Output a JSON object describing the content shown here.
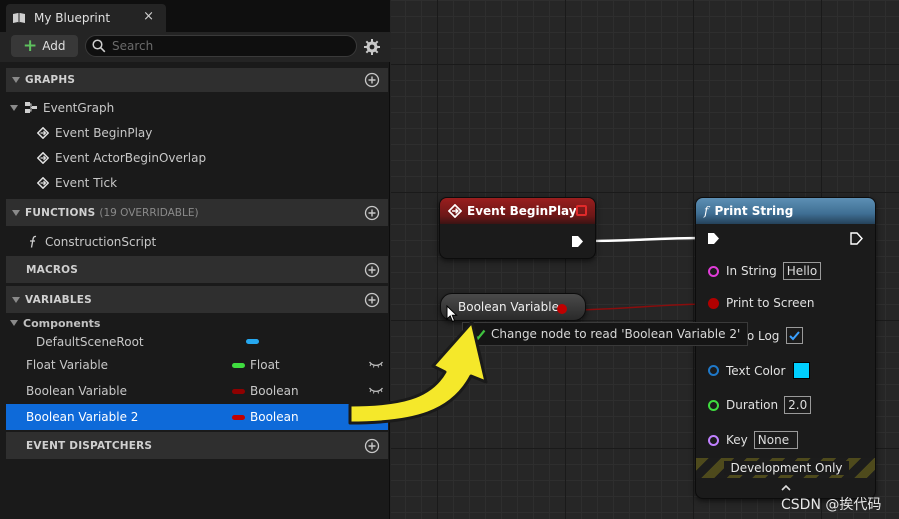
{
  "tab": {
    "title": "My Blueprint",
    "close": "×"
  },
  "toolbar": {
    "add_label": "Add",
    "search_placeholder": "Search"
  },
  "sections": {
    "graphs": "GRAPHS",
    "functions": "FUNCTIONS",
    "functions_note": "(19 OVERRIDABLE)",
    "macros": "MACROS",
    "variables": "VARIABLES",
    "event_dispatchers": "EVENT DISPATCHERS"
  },
  "graph_tree": {
    "event_graph": "EventGraph",
    "events": [
      "Event BeginPlay",
      "Event ActorBeginOverlap",
      "Event Tick"
    ]
  },
  "functions": [
    "ConstructionScript"
  ],
  "variables": {
    "components_label": "Components",
    "components": [
      {
        "name": "DefaultSceneRoot",
        "color": "#26a8f0"
      }
    ],
    "items": [
      {
        "name": "Float Variable",
        "type": "Float",
        "color": "#3fdc3f",
        "selected": false
      },
      {
        "name": "Boolean Variable",
        "type": "Boolean",
        "color": "#8f0000",
        "selected": false
      },
      {
        "name": "Boolean Variable 2",
        "type": "Boolean",
        "color": "#c00000",
        "selected": true
      }
    ]
  },
  "nodes": {
    "event_begin_play": {
      "title": "Event BeginPlay"
    },
    "print_string": {
      "title": "Print String",
      "pins": {
        "in_string": {
          "label": "In String",
          "value": "Hello"
        },
        "print_to_screen": {
          "label": "Print to Screen"
        },
        "print_to_log": {
          "label": "Print to Log",
          "visible_label": "nt to Log"
        },
        "text_color": {
          "label": "Text Color",
          "value_color": "#00cfff"
        },
        "duration": {
          "label": "Duration",
          "value": "2.0"
        },
        "key": {
          "label": "Key",
          "value": "None"
        }
      },
      "footer": "Development Only"
    },
    "boolean_variable": {
      "title": "Boolean Variable"
    }
  },
  "tooltip": {
    "text": "Change node to read 'Boolean Variable 2'"
  },
  "watermark": "CSDN @挨代码",
  "colors": {
    "accent_selected": "#0e6ad9",
    "event_header": "#9a1e1e",
    "function_header": "#4a7fa6",
    "bool_pin": "#b00000",
    "string_pin": "#e03cd8",
    "float_pin": "#3fdc3f",
    "struct_pin": "#1f78c8",
    "name_pin": "#c080ff",
    "arrow_fill": "#f5e82a"
  }
}
